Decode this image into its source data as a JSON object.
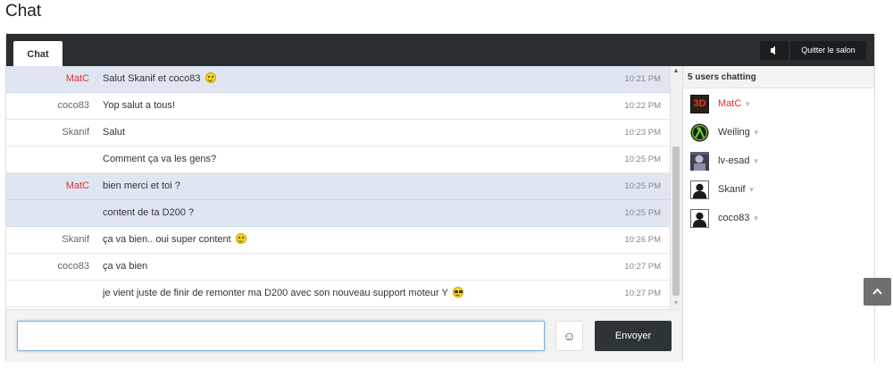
{
  "page": {
    "title": "Chat"
  },
  "topbar": {
    "tab_label": "Chat",
    "sound_icon": "speaker-icon",
    "quit_label": "Quitter le salon"
  },
  "messages": [
    {
      "user": "MatC",
      "user_color": "#e03030",
      "text": "Salut Skanif et coco83",
      "emoji": "smiley",
      "time": "10:21 PM",
      "highlight": true
    },
    {
      "user": "coco83",
      "text": "Yop salut a tous!",
      "time": "10:22 PM",
      "highlight": false
    },
    {
      "user": "Skanif",
      "text": "Salut",
      "time": "10:23 PM",
      "highlight": false
    },
    {
      "user": "",
      "text": "Comment ça va les gens?",
      "time": "10:25 PM",
      "highlight": false
    },
    {
      "user": "MatC",
      "user_color": "#e03030",
      "text": "bien merci et toi ?",
      "time": "10:25 PM",
      "highlight": true
    },
    {
      "user": "",
      "text": "content de ta D200 ?",
      "time": "10:25 PM",
      "highlight": true
    },
    {
      "user": "Skanif",
      "text": "ça va bien.. oui super content",
      "emoji": "smiley",
      "time": "10:26 PM",
      "highlight": false
    },
    {
      "user": "coco83",
      "text": "ça va bien",
      "time": "10:27 PM",
      "highlight": false
    },
    {
      "user": "",
      "text": "je vient juste de finir de remonter ma D200 avec son nouveau support moteur Y",
      "emoji": "cool",
      "time": "10:27 PM",
      "highlight": false
    }
  ],
  "users": {
    "header": "5 users chatting",
    "list": [
      {
        "name": "MatC",
        "color": "#e03030",
        "avatar": "3d-avatar",
        "avatar_text": "3D"
      },
      {
        "name": "Weiling",
        "avatar": "lambda-avatar"
      },
      {
        "name": "lv-esad",
        "avatar": "photo-avatar"
      },
      {
        "name": "Skanif",
        "avatar": "default-avatar"
      },
      {
        "name": "coco83",
        "avatar": "default-avatar"
      }
    ]
  },
  "composer": {
    "input_value": "",
    "input_placeholder": "",
    "emoji_icon": "☺",
    "send_label": "Envoyer"
  },
  "scroll_top_icon": "chevron-up-icon"
}
